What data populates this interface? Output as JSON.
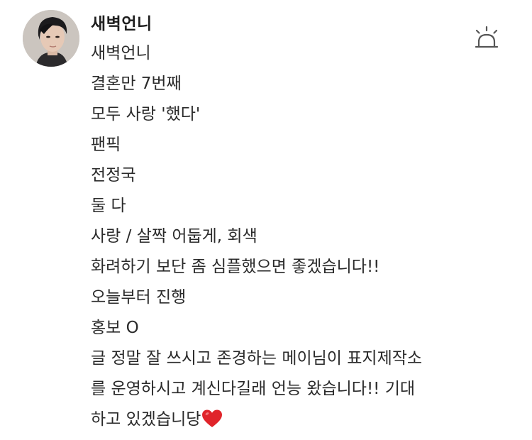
{
  "comment": {
    "author": "새벽언니",
    "lines": [
      "새벽언니",
      "결혼만 7번째",
      "모두 사랑 '했다'",
      "팬픽",
      "전정국",
      "둘 다",
      "사랑 / 살짝 어둡게, 회색",
      "화려하기 보단 좀 심플했으면 좋겠습니다!!",
      "오늘부터 진행",
      "홍보 O",
      "글 정말 잘 쓰시고 존경하는 메이님이 표지제작소",
      "를 운영하시고 계신다길래 언능 왔습니다!! 기대",
      "하고 있겠습니당"
    ],
    "trailing_emoji": "heart-icon"
  },
  "colors": {
    "text": "#2a2a2a",
    "heart": "#e0242a",
    "icon_stroke": "#555555"
  }
}
